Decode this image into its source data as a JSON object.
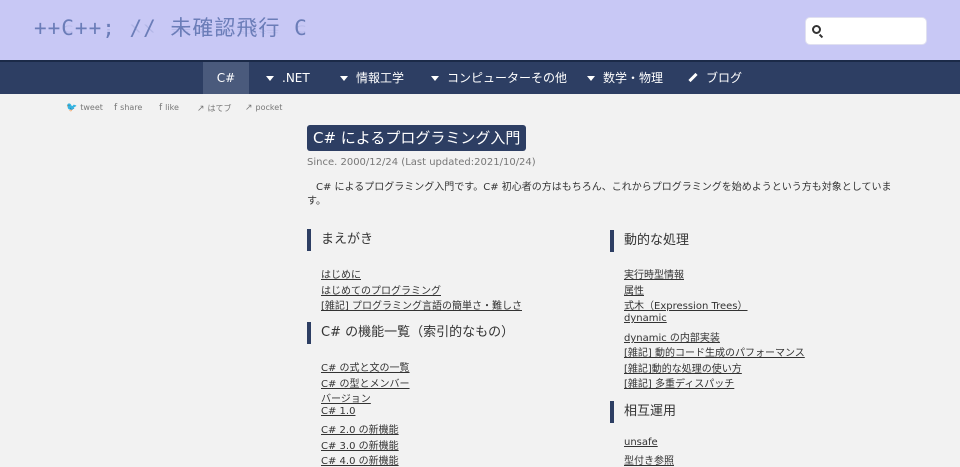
{
  "header": {
    "logo": "++C++; // 未確認飛行 C",
    "search_placeholder": ""
  },
  "nav": {
    "items": [
      {
        "label": "C#"
      },
      {
        "label": ".NET"
      },
      {
        "label": "情報工学"
      },
      {
        "label": "コンピューターその他"
      },
      {
        "label": "数学・物理"
      },
      {
        "label": "ブログ"
      }
    ]
  },
  "share": {
    "tweet": "tweet",
    "share": "share",
    "like": "like",
    "hatebu": "はてブ",
    "pocket": "pocket"
  },
  "main": {
    "title": "C# によるプログラミング入門",
    "since": "Since. 2000/12/24 (Last updated:2021/10/24)",
    "intro": "C# によるプログラミング入門です。C# 初心者の方はもちろん、これからプログラミングを始めようという方も対象としています。"
  },
  "sections": {
    "maegaki": {
      "title": "まえがき",
      "links": [
        "はじめに",
        "はじめてのプログラミング",
        "[雑記] プログラミング言語の簡単さ・難しさ"
      ]
    },
    "features": {
      "title": "C# の機能一覧（索引的なもの）",
      "links": [
        "C# の式と文の一覧",
        "C# の型とメンバー",
        "バージョン",
        "C# 1.0",
        "C# 2.0 の新機能",
        "C# 3.0 の新機能",
        "C# 4.0 の新機能"
      ]
    },
    "dynamic": {
      "title": "動的な処理",
      "links": [
        "実行時型情報",
        "属性",
        "式木（Expression Trees）",
        "dynamic",
        "dynamic の内部実装",
        "[雑記] 動的コード生成のパフォーマンス",
        "[雑記]動的な処理の使い方",
        "[雑記] 多重ディスパッチ"
      ]
    },
    "interop": {
      "title": "相互運用",
      "links": [
        "unsafe",
        "型付き参照"
      ]
    }
  }
}
